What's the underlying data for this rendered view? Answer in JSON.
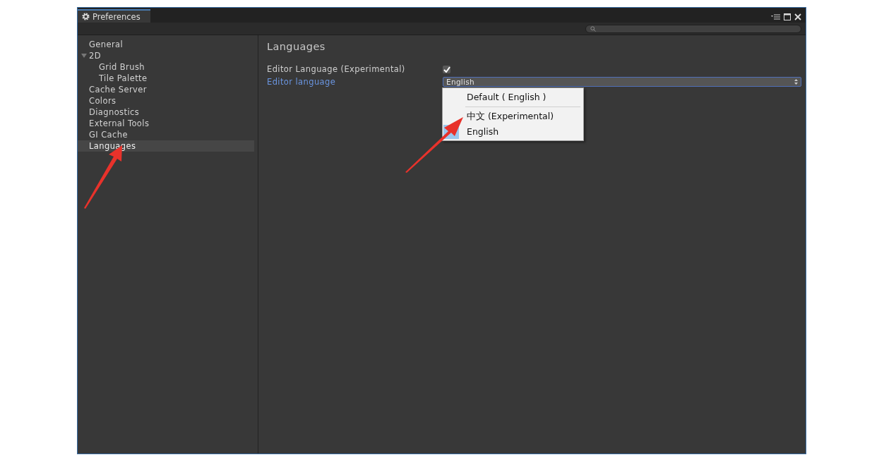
{
  "window": {
    "title": "Preferences"
  },
  "sidebar": {
    "items": [
      {
        "label": "General",
        "selected": false
      },
      {
        "label": "2D",
        "selected": false,
        "expanded": true,
        "children": [
          {
            "label": "Grid Brush",
            "selected": false
          },
          {
            "label": "Tile Palette",
            "selected": false
          }
        ]
      },
      {
        "label": "Cache Server",
        "selected": false
      },
      {
        "label": "Colors",
        "selected": false
      },
      {
        "label": "Diagnostics",
        "selected": false
      },
      {
        "label": "External Tools",
        "selected": false
      },
      {
        "label": "GI Cache",
        "selected": false
      },
      {
        "label": "Languages",
        "selected": true
      }
    ]
  },
  "content": {
    "heading": "Languages",
    "settings": [
      {
        "kind": "checkbox",
        "label": "Editor Language (Experimental)",
        "checked": true,
        "focused": false
      },
      {
        "kind": "dropdown",
        "label": "Editor language",
        "value": "English",
        "focused": true
      }
    ],
    "menu": {
      "items": [
        {
          "label": "Default ( English )",
          "selected": false,
          "separator_after": true
        },
        {
          "label": "中文 (Experimental)",
          "selected": false,
          "separator_after": false
        },
        {
          "label": "English",
          "selected": true,
          "separator_after": false
        }
      ]
    }
  }
}
